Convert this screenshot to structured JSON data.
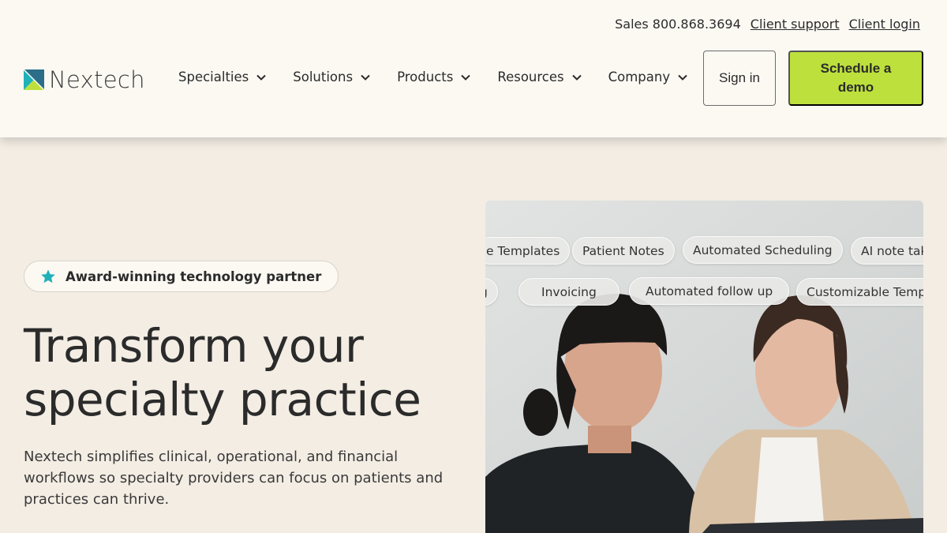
{
  "utility": {
    "sales": "Sales 800.868.3694",
    "support": "Client support",
    "login": "Client login"
  },
  "logo": {
    "text": "Nextech"
  },
  "nav": [
    {
      "label": "Specialties"
    },
    {
      "label": "Solutions"
    },
    {
      "label": "Products"
    },
    {
      "label": "Resources"
    },
    {
      "label": "Company"
    }
  ],
  "buttons": {
    "signin": "Sign in",
    "demo": "Schedule a demo"
  },
  "hero": {
    "badge": "Award-winning technology partner",
    "headline": "Transform your specialty practice",
    "subtext": "Nextech simplifies clinical, operational, and financial workflows so specialty providers can focus on patients and practices can thrive."
  },
  "chips": {
    "row1": [
      "e Templates",
      "Patient Notes",
      "Automated Scheduling",
      "AI note tak"
    ],
    "row2": [
      "g",
      "Invoicing",
      "Automated follow up",
      "Customizable Temp"
    ]
  },
  "icons": {
    "badge": "star-icon",
    "nav": "chevron-down-icon",
    "logo": "nextech-logo-icon"
  },
  "colors": {
    "background": "#f3ede4",
    "header": "#fcf9f3",
    "accent": "#bde03c",
    "teal": "#1fb1b8"
  }
}
